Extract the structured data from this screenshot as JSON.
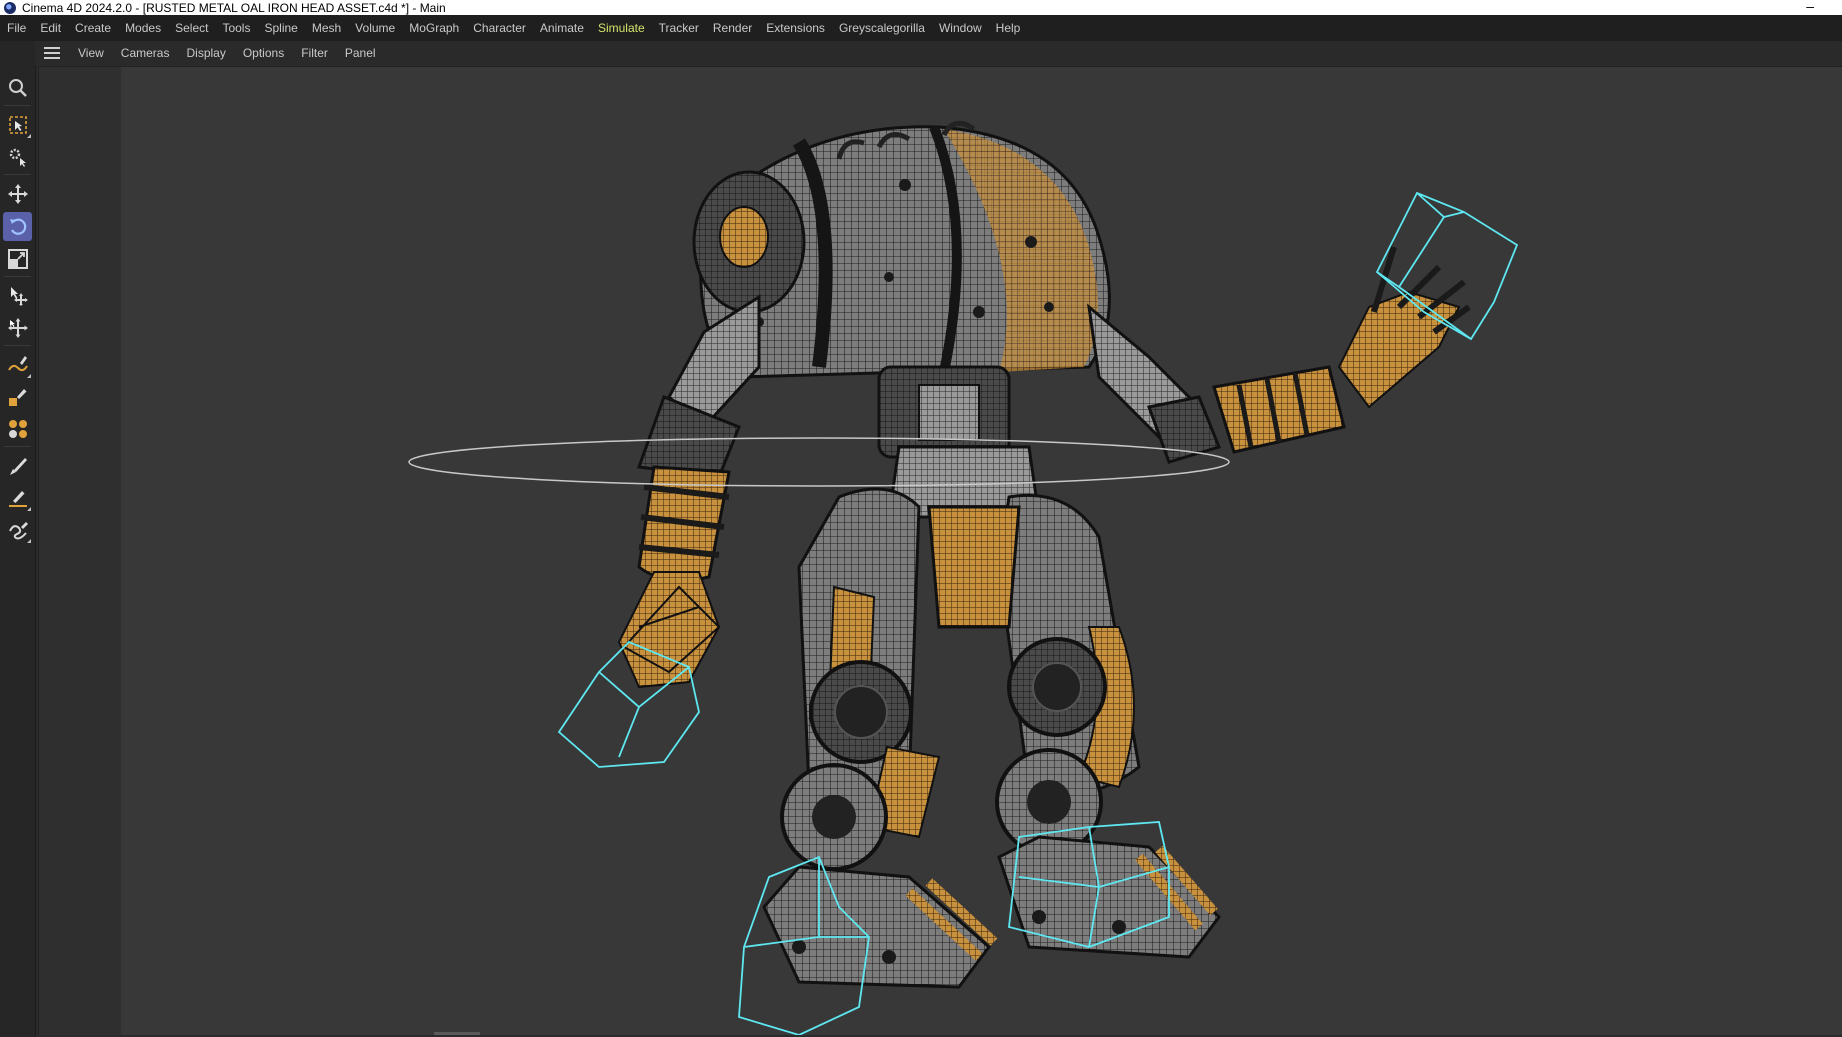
{
  "window": {
    "title": "Cinema 4D 2024.2.0 - [RUSTED METAL OAL IRON HEAD ASSET.c4d *] - Main",
    "minimize_glyph": "–"
  },
  "menubar": {
    "items": [
      "File",
      "Edit",
      "Create",
      "Modes",
      "Select",
      "Tools",
      "Spline",
      "Mesh",
      "Volume",
      "MoGraph",
      "Character",
      "Animate",
      "Simulate",
      "Tracker",
      "Render",
      "Extensions",
      "Greyscalegorilla",
      "Window",
      "Help"
    ],
    "active_item": "Simulate",
    "active_color": "#d6e36a"
  },
  "viewport_menu": {
    "items": [
      "View",
      "Cameras",
      "Display",
      "Options",
      "Filter",
      "Panel"
    ]
  },
  "tools": [
    {
      "icon": "search-icon"
    },
    {
      "icon": "live-selection-icon"
    },
    {
      "icon": "settings-select-icon"
    },
    {
      "icon": "move-icon"
    },
    {
      "icon": "rotate-icon",
      "selected": true
    },
    {
      "icon": "scale-icon"
    },
    {
      "icon": "transfer-move-icon"
    },
    {
      "icon": "tweak-icon"
    },
    {
      "icon": "spline-pen-icon"
    },
    {
      "icon": "spline-paint-icon"
    },
    {
      "icon": "sculpt-icon"
    },
    {
      "icon": "brush-icon"
    },
    {
      "icon": "spline-draw-icon"
    },
    {
      "icon": "sketch-icon"
    }
  ],
  "colors": {
    "selection_accent": "#5b61a8",
    "control_cubes": "#5ee7f0",
    "rust_orange": "#c8913d",
    "wireframe_grey": "#8a8a8a"
  },
  "viewport_content": "3d-robot-wireframe-model"
}
